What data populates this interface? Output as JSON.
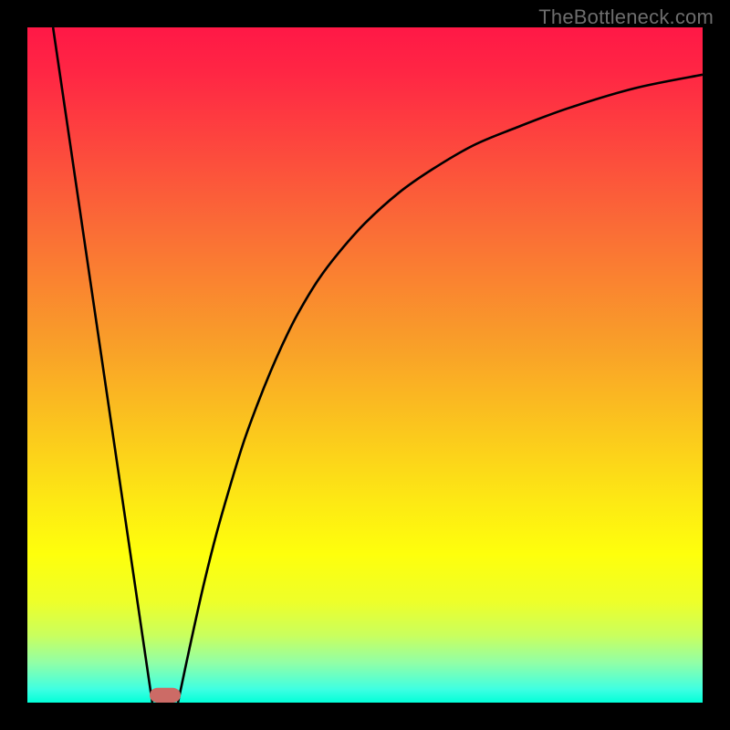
{
  "watermark": "TheBottleneck.com",
  "chart_data": {
    "type": "line",
    "title": "",
    "xlabel": "",
    "ylabel": "",
    "xlim": [
      0,
      100
    ],
    "ylim": [
      0,
      100
    ],
    "grid": false,
    "background_gradient": {
      "stops": [
        {
          "offset": 0.0,
          "color": "#ff1846"
        },
        {
          "offset": 0.07,
          "color": "#ff2744"
        },
        {
          "offset": 0.3,
          "color": "#fa6d36"
        },
        {
          "offset": 0.48,
          "color": "#f9a228"
        },
        {
          "offset": 0.6,
          "color": "#fbc81d"
        },
        {
          "offset": 0.7,
          "color": "#fde814"
        },
        {
          "offset": 0.78,
          "color": "#feff0c"
        },
        {
          "offset": 0.85,
          "color": "#eeff29"
        },
        {
          "offset": 0.9,
          "color": "#caff5d"
        },
        {
          "offset": 0.94,
          "color": "#93ffa5"
        },
        {
          "offset": 0.98,
          "color": "#3fffe2"
        },
        {
          "offset": 1.0,
          "color": "#02ffd8"
        }
      ]
    },
    "series": [
      {
        "name": "left-segment",
        "x": [
          3.8,
          18.5
        ],
        "y": [
          100,
          0
        ]
      },
      {
        "name": "right-curve",
        "x": [
          22.3,
          24,
          26,
          28,
          30,
          32,
          34,
          36,
          38,
          40,
          43,
          46,
          50,
          55,
          60,
          66,
          72,
          80,
          90,
          100
        ],
        "y": [
          0,
          8,
          17,
          25,
          32,
          38.5,
          44,
          49,
          53.5,
          57.5,
          62.5,
          66.5,
          71,
          75.5,
          79,
          82.5,
          85,
          88,
          91,
          93
        ]
      }
    ],
    "marker": {
      "x": 20.4,
      "width": 4.6,
      "height": 2.2,
      "fill": "#cc6b66",
      "rx": 1.2
    },
    "curve_stroke": "#000000",
    "curve_width": 2.6
  }
}
